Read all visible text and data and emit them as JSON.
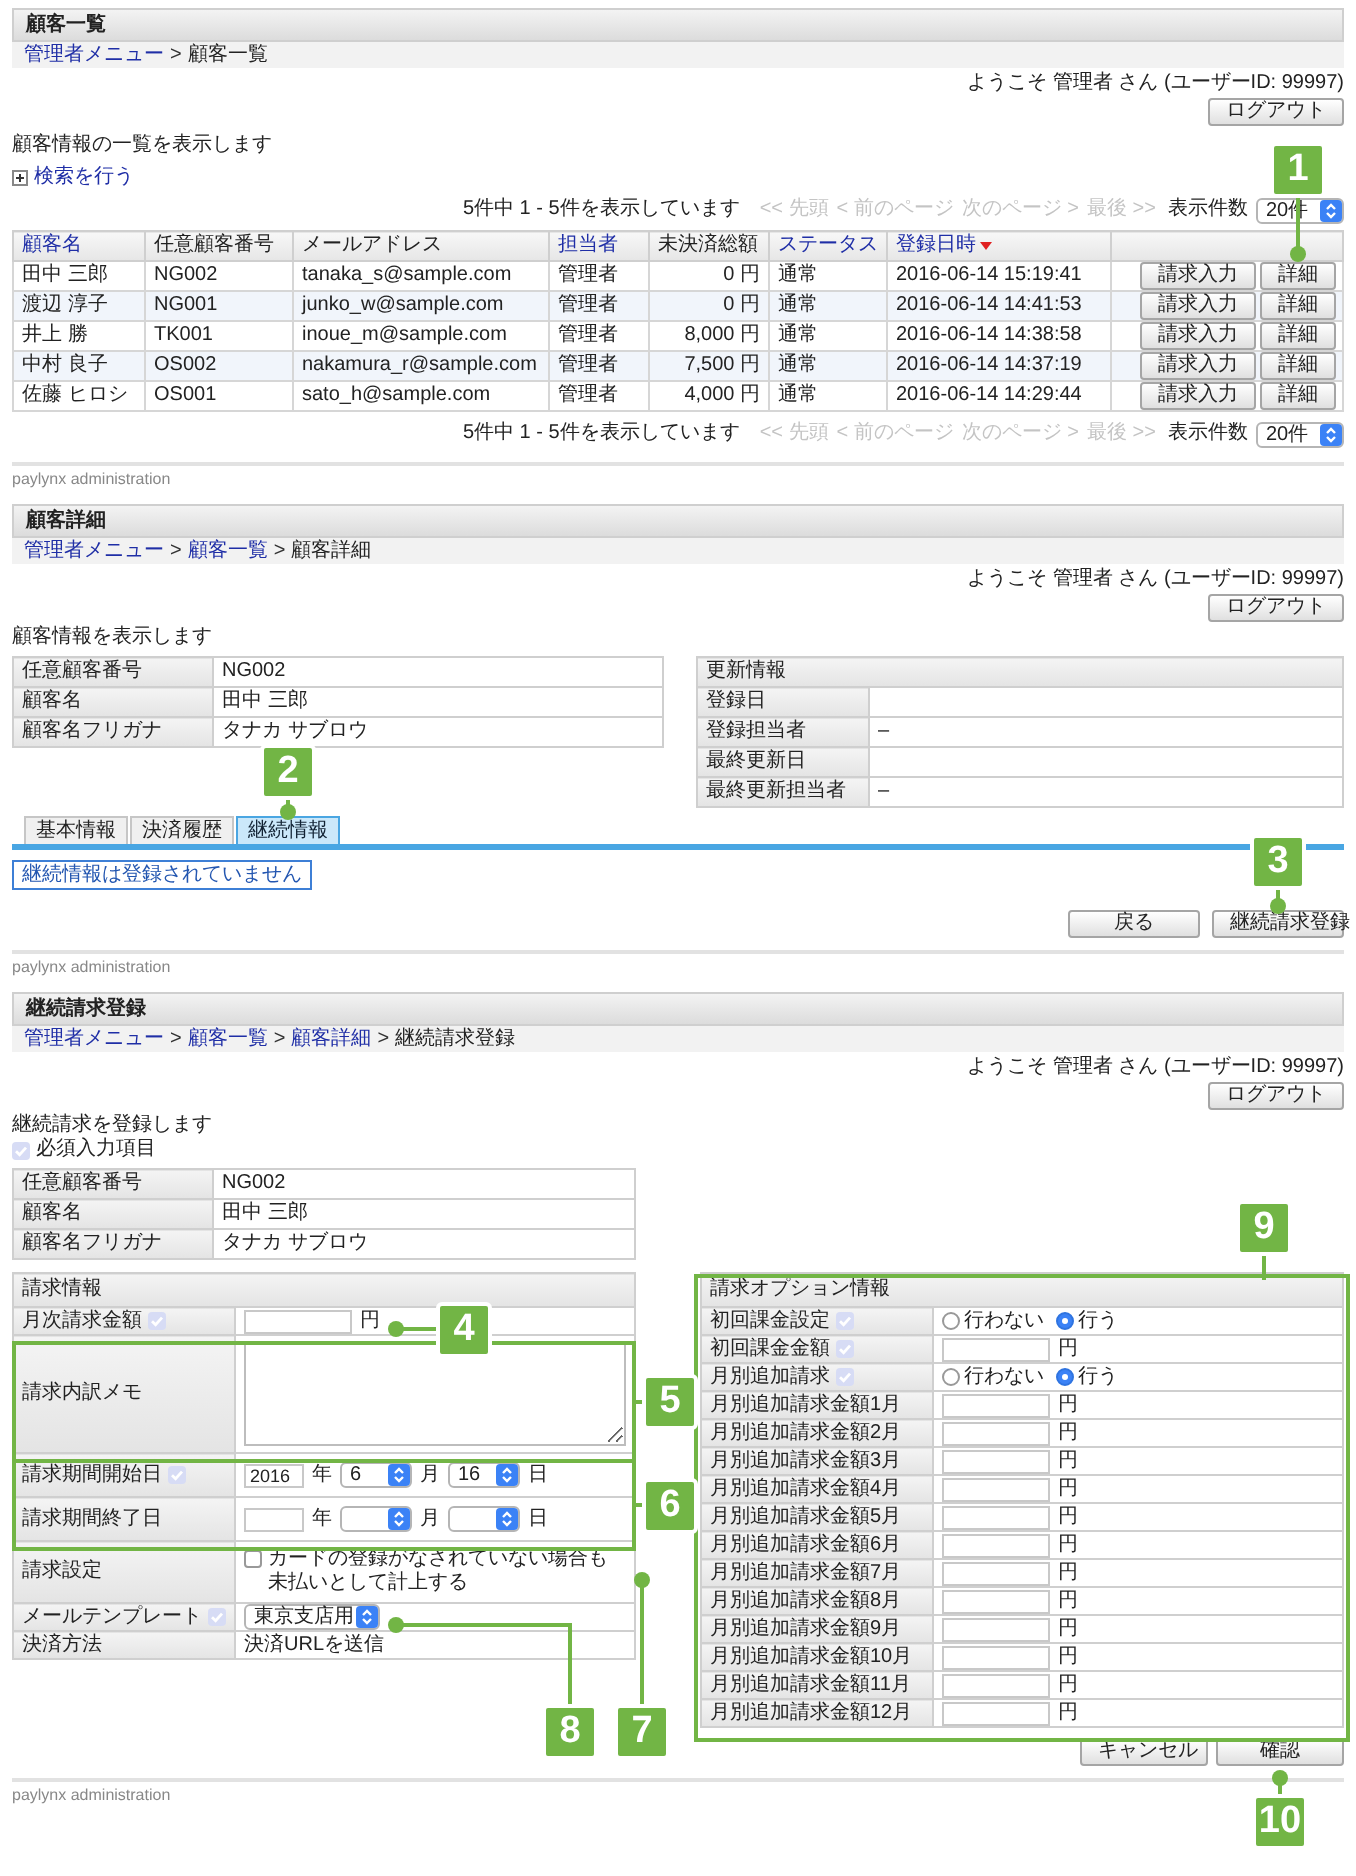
{
  "customer_list": {
    "title": "顧客一覧",
    "breadcrumb": [
      {
        "kind": "link",
        "text": "管理者メニュー"
      },
      {
        "kind": "separator",
        "text": ">"
      },
      {
        "kind": "current",
        "text": "顧客一覧"
      }
    ],
    "welcome": "ようこそ 管理者 さん (ユーザーID: 99997)",
    "logout_button": "ログアウト",
    "description": "顧客情報の一覧を表示します",
    "search_link": "検索を行う",
    "pagination_top": {
      "summary": "5件中 1 - 5件を表示しています",
      "nav": [
        {
          "text": "<< 先頭",
          "disabled": true
        },
        {
          "text": "< 前のページ",
          "disabled": true
        },
        {
          "text": "次のページ >",
          "disabled": true
        },
        {
          "text": "最後 >>",
          "disabled": true
        }
      ],
      "per_page_label": "表示件数",
      "per_page": "20件"
    },
    "table": {
      "columns": [
        {
          "label": "顧客名",
          "sortable": true,
          "sorted": false
        },
        {
          "label": "任意顧客番号",
          "sortable": false,
          "sorted": false
        },
        {
          "label": "メールアドレス",
          "sortable": false,
          "sorted": false
        },
        {
          "label": "担当者",
          "sortable": true,
          "sorted": false
        },
        {
          "label": "未決済総額",
          "sortable": false,
          "sorted": false
        },
        {
          "label": "ステータス",
          "sortable": true,
          "sorted": false
        },
        {
          "label": "登録日時",
          "sortable": true,
          "sorted": true
        }
      ],
      "rows": [
        {
          "cells": [
            "田中 三郎",
            "NG002",
            "tanaka_s@sample.com",
            "管理者",
            "0 円",
            "通常",
            "2016-06-14 15:19:41"
          ],
          "buttons": [
            "請求入力",
            "詳細"
          ]
        },
        {
          "cells": [
            "渡辺 淳子",
            "NG001",
            "junko_w@sample.com",
            "管理者",
            "0 円",
            "通常",
            "2016-06-14 14:41:53"
          ],
          "buttons": [
            "請求入力",
            "詳細"
          ]
        },
        {
          "cells": [
            "井上 勝",
            "TK001",
            "inoue_m@sample.com",
            "管理者",
            "8,000 円",
            "通常",
            "2016-06-14 14:38:58"
          ],
          "buttons": [
            "請求入力",
            "詳細"
          ]
        },
        {
          "cells": [
            "中村 良子",
            "OS002",
            "nakamura_r@sample.com",
            "管理者",
            "7,500 円",
            "通常",
            "2016-06-14 14:37:19"
          ],
          "buttons": [
            "請求入力",
            "詳細"
          ]
        },
        {
          "cells": [
            "佐藤 ヒロシ",
            "OS001",
            "sato_h@sample.com",
            "管理者",
            "4,000 円",
            "通常",
            "2016-06-14 14:29:44"
          ],
          "buttons": [
            "請求入力",
            "詳細"
          ]
        }
      ]
    },
    "pagination_bottom": {
      "summary": "5件中 1 - 5件を表示しています",
      "nav": [
        {
          "text": "<< 先頭",
          "disabled": true
        },
        {
          "text": "< 前のページ",
          "disabled": true
        },
        {
          "text": "次のページ >",
          "disabled": true
        },
        {
          "text": "最後 >>",
          "disabled": true
        }
      ],
      "per_page_label": "表示件数",
      "per_page": "20件"
    },
    "footer": "paylynx administration"
  },
  "customer_detail": {
    "title": "顧客詳細",
    "breadcrumb": [
      {
        "kind": "link",
        "text": "管理者メニュー"
      },
      {
        "kind": "separator",
        "text": ">"
      },
      {
        "kind": "link",
        "text": "顧客一覧"
      },
      {
        "kind": "separator",
        "text": ">"
      },
      {
        "kind": "current",
        "text": "顧客詳細"
      }
    ],
    "welcome": "ようこそ 管理者 さん (ユーザーID: 99997)",
    "logout_button": "ログアウト",
    "description": "顧客情報を表示します",
    "customer_info": [
      {
        "label": "任意顧客番号",
        "value": "NG002"
      },
      {
        "label": "顧客名",
        "value": "田中 三郎"
      },
      {
        "label": "顧客名フリガナ",
        "value": "タナカ サブロウ"
      }
    ],
    "update_info": {
      "heading": "更新情報",
      "rows": [
        {
          "label": "登録日"
        },
        {
          "label": "登録担当者",
          "value": "–"
        },
        {
          "label": "最終更新日"
        },
        {
          "label": "最終更新担当者",
          "value": "–"
        }
      ]
    },
    "tabs": [
      {
        "label": "基本情報",
        "selected": false
      },
      {
        "label": "決済履歴",
        "selected": false
      },
      {
        "label": "継続情報",
        "selected": true
      }
    ],
    "notice": "継続情報は登録されていません",
    "buttons": [
      "戻る",
      "継続請求登録"
    ],
    "footer": "paylynx administration"
  },
  "recurring_billing_registration": {
    "title": "継続請求登録",
    "breadcrumb": [
      {
        "kind": "link",
        "text": "管理者メニュー"
      },
      {
        "kind": "separator",
        "text": ">"
      },
      {
        "kind": "link",
        "text": "顧客一覧"
      },
      {
        "kind": "separator",
        "text": ">"
      },
      {
        "kind": "link",
        "text": "顧客詳細"
      },
      {
        "kind": "separator",
        "text": ">"
      },
      {
        "kind": "current",
        "text": "継続請求登録"
      }
    ],
    "welcome": "ようこそ 管理者 さん (ユーザーID: 99997)",
    "logout_button": "ログアウト",
    "description": "継続請求を登録します",
    "required_legend": "必須入力項目",
    "customer_info": [
      {
        "label": "任意顧客番号",
        "value": "NG002"
      },
      {
        "label": "顧客名",
        "value": "田中 三郎"
      },
      {
        "label": "顧客名フリガナ",
        "value": "タナカ サブロウ"
      }
    ],
    "billing": {
      "heading": "請求情報",
      "rows": [
        {
          "kind": "amount",
          "label": "月次請求金額",
          "required": true,
          "unit": "円"
        },
        {
          "kind": "memo",
          "label": "請求内訳メモ",
          "required": false
        },
        {
          "kind": "date",
          "label": "請求期間開始日",
          "required": true,
          "year": "2016",
          "year_unit": "年",
          "month": "6",
          "month_unit": "月",
          "day": "16",
          "day_unit": "日"
        },
        {
          "kind": "date",
          "label": "請求期間終了日",
          "required": false,
          "year_unit": "年",
          "month_unit": "月",
          "day_unit": "日"
        },
        {
          "kind": "checkbox",
          "label": "請求設定",
          "required": false,
          "text": "カードの登録がなされていない場合も未払いとして計上する",
          "checked": false
        },
        {
          "kind": "select",
          "label": "メールテンプレート",
          "required": true,
          "value": "東京支店用"
        },
        {
          "kind": "text",
          "label": "決済方法",
          "required": false,
          "value": "決済URLを送信"
        }
      ]
    },
    "options": {
      "heading": "請求オプション情報",
      "rows": [
        {
          "kind": "radio",
          "label": "初回課金設定",
          "required": true,
          "options": [
            {
              "label": "行わない",
              "selected": false
            },
            {
              "label": "行う",
              "selected": true
            }
          ]
        },
        {
          "kind": "amount",
          "label": "初回課金金額",
          "required": true,
          "unit": "円"
        },
        {
          "kind": "radio",
          "label": "月別追加請求",
          "required": true,
          "options": [
            {
              "label": "行わない",
              "selected": false
            },
            {
              "label": "行う",
              "selected": true
            }
          ]
        },
        {
          "kind": "amount",
          "label": "月別追加請求金額1月",
          "required": false,
          "unit": "円"
        },
        {
          "kind": "amount",
          "label": "月別追加請求金額2月",
          "required": false,
          "unit": "円"
        },
        {
          "kind": "amount",
          "label": "月別追加請求金額3月",
          "required": false,
          "unit": "円"
        },
        {
          "kind": "amount",
          "label": "月別追加請求金額4月",
          "required": false,
          "unit": "円"
        },
        {
          "kind": "amount",
          "label": "月別追加請求金額5月",
          "required": false,
          "unit": "円"
        },
        {
          "kind": "amount",
          "label": "月別追加請求金額6月",
          "required": false,
          "unit": "円"
        },
        {
          "kind": "amount",
          "label": "月別追加請求金額7月",
          "required": false,
          "unit": "円"
        },
        {
          "kind": "amount",
          "label": "月別追加請求金額8月",
          "required": false,
          "unit": "円"
        },
        {
          "kind": "amount",
          "label": "月別追加請求金額9月",
          "required": false,
          "unit": "円"
        },
        {
          "kind": "amount",
          "label": "月別追加請求金額10月",
          "required": false,
          "unit": "円"
        },
        {
          "kind": "amount",
          "label": "月別追加請求金額11月",
          "required": false,
          "unit": "円"
        },
        {
          "kind": "amount",
          "label": "月別追加請求金額12月",
          "required": false,
          "unit": "円"
        }
      ]
    },
    "buttons": [
      "キャンセル",
      "確認"
    ],
    "footer": "paylynx administration"
  },
  "callouts": [
    "1",
    "2",
    "3",
    "4",
    "5",
    "6",
    "7",
    "8",
    "9",
    "10"
  ]
}
